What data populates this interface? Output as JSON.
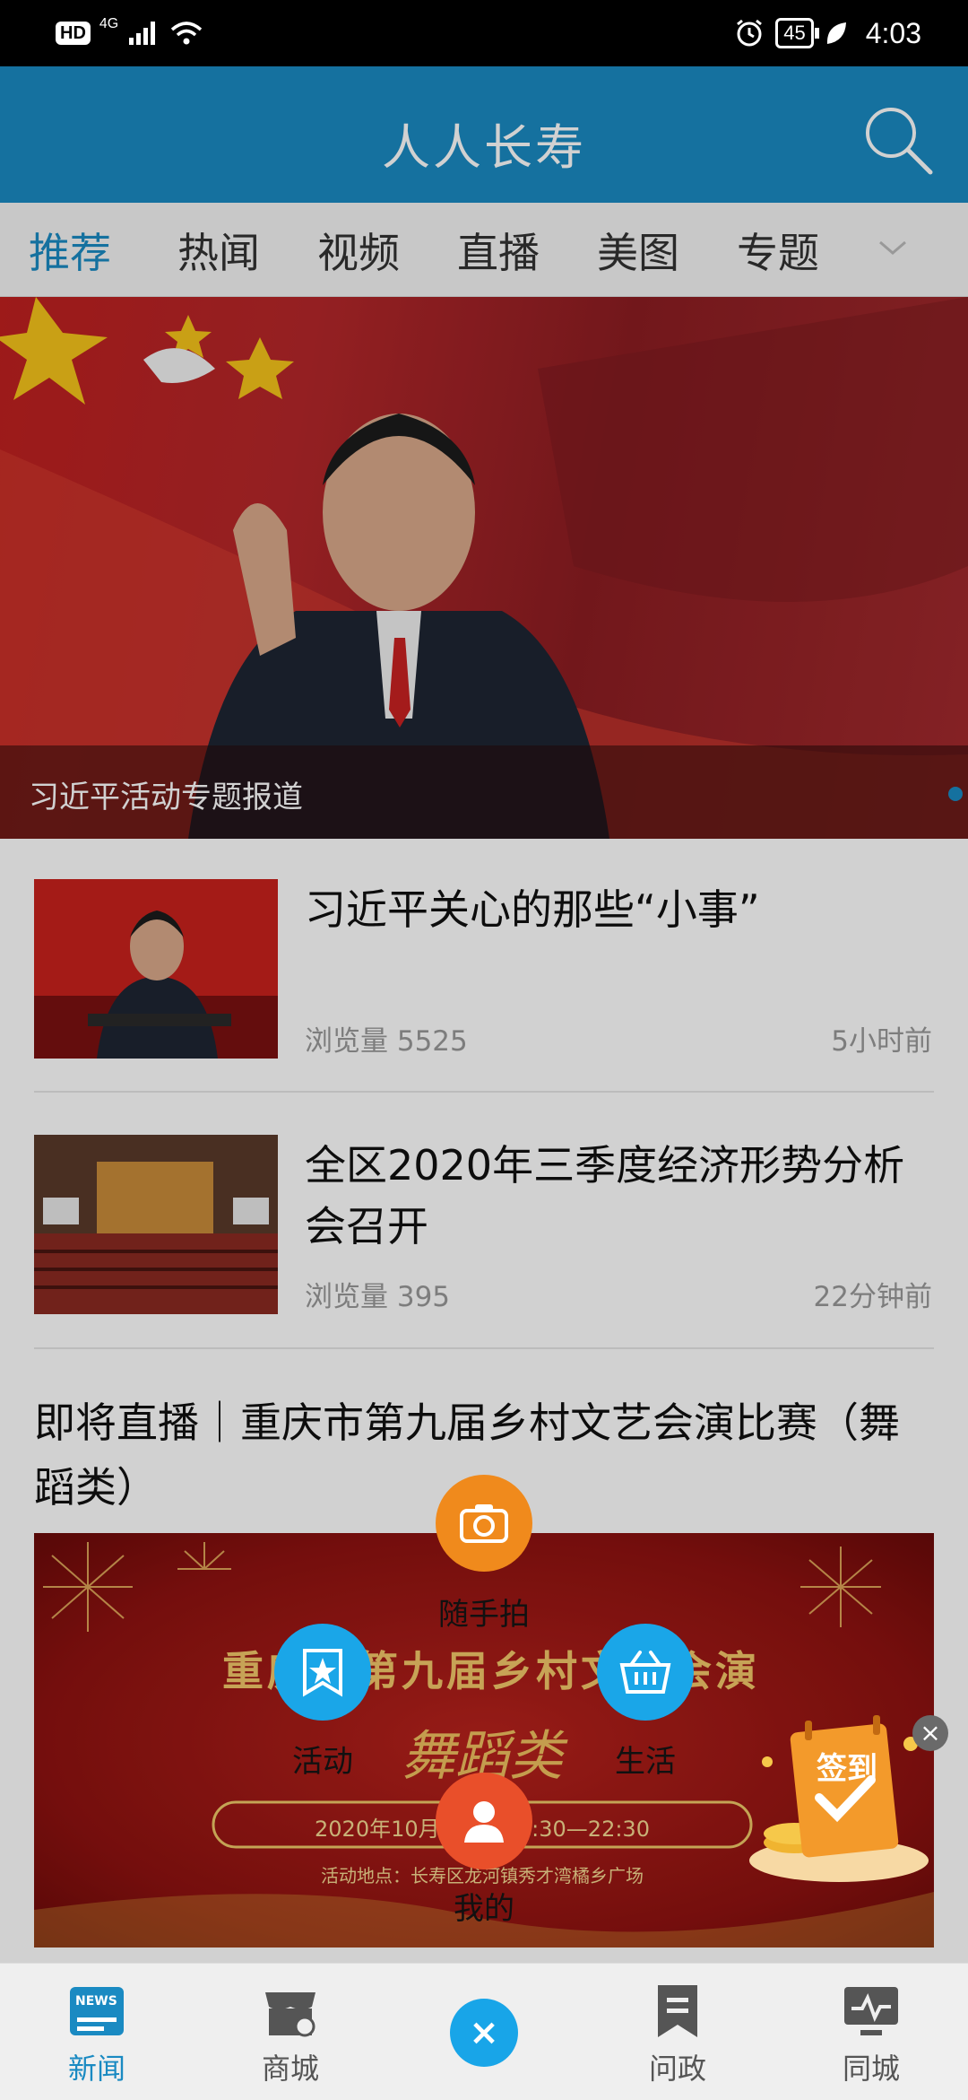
{
  "status_bar": {
    "hd": "HD",
    "network": "4G",
    "battery": "45",
    "time": "4:03"
  },
  "app": {
    "title": "人人长寿"
  },
  "tabs": [
    {
      "label": "推荐"
    },
    {
      "label": "热闻"
    },
    {
      "label": "视频"
    },
    {
      "label": "直播"
    },
    {
      "label": "美图"
    },
    {
      "label": "专题"
    }
  ],
  "hero": {
    "caption": "习近平活动专题报道"
  },
  "news": [
    {
      "title": "习近平关心的那些“小事”",
      "views": "浏览量 5525",
      "time": "5小时前"
    },
    {
      "title": "全区2020年三季度经济形势分析会召开",
      "views": "浏览量 395",
      "time": "22分钟前"
    }
  ],
  "live": {
    "title": "即将直播｜重庆市第九届乡村文艺会演比赛（舞蹈类）",
    "banner_title": "重庆市第九届乡村文艺会演",
    "banner_subtitle": "舞蹈类",
    "banner_time": "2020年10月　　　19:30—22:30",
    "banner_place": "活动地点：长寿区龙河镇秀才湾橘乡广场"
  },
  "fab_menu": {
    "photo_label": "随手拍",
    "activity_label": "活动",
    "life_label": "生活",
    "mine_label": "我的"
  },
  "checkin": {
    "label": "签到",
    "close": "×"
  },
  "bottom_nav": [
    {
      "label": "新闻",
      "badge": "NEWS"
    },
    {
      "label": "商城"
    },
    {
      "label": "问政"
    },
    {
      "label": "同城"
    }
  ],
  "center_close": "×",
  "colors": {
    "primary": "#1a8ac2",
    "fab_orange": "#f08a1c",
    "fab_blue": "#1aa6e8",
    "fab_red": "#e94f2a"
  }
}
